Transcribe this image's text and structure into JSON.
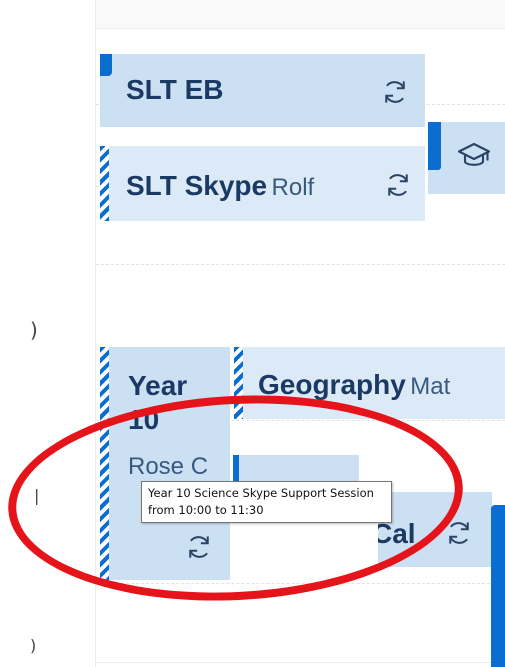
{
  "timeline": {
    "ticks": [
      ")",
      ")",
      "("
    ]
  },
  "events": {
    "slt_eb": {
      "title": "SLT EB",
      "icon": "sync-icon"
    },
    "slt_skype": {
      "title": "SLT Skype",
      "subtitle": "Rolf",
      "icon": "sync-icon"
    },
    "course": {
      "icon": "graduation-cap-icon"
    },
    "year10": {
      "title_line1": "Year",
      "title_line2": "10",
      "subtitle": "Rose C",
      "icon": "sync-icon"
    },
    "geography": {
      "title": "Geography",
      "subtitle": "Mat"
    },
    "cal": {
      "title": "Cal",
      "icon": "sync-icon"
    }
  },
  "tooltip": {
    "line1": "Year 10 Science Skype Support Session",
    "line2": "from 10:00 to 11:30"
  },
  "colors": {
    "accent": "#0a6ed1",
    "event_bg": "#cce0f4",
    "annotation": "#e5141b"
  }
}
